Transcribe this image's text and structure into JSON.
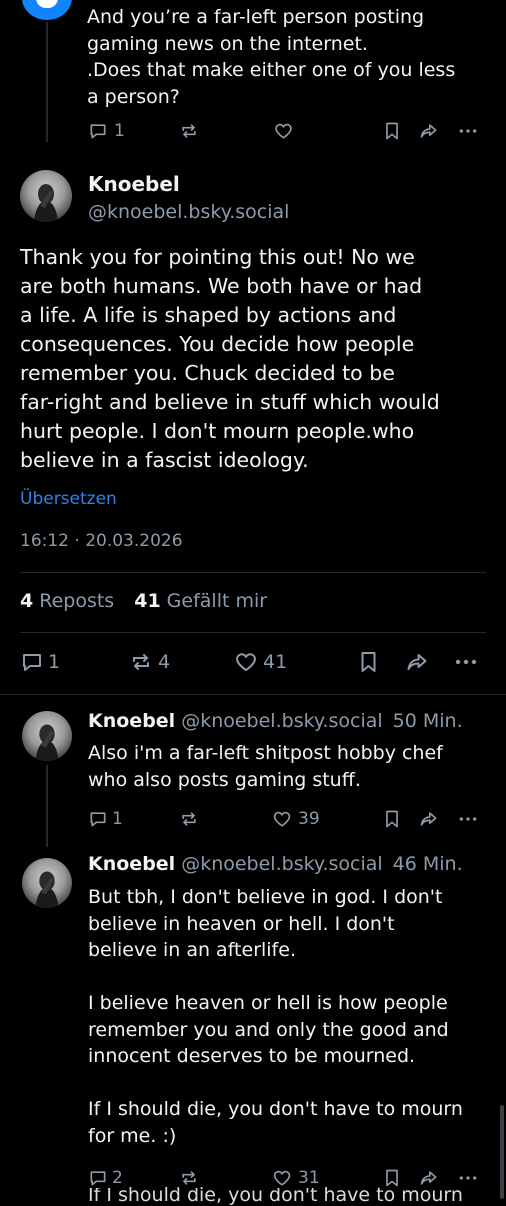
{
  "top_post": {
    "text_lines": [
      "And you’re a far-left person posting",
      "gaming news on the internet.",
      ".Does that make either one of you less",
      "a person?"
    ],
    "replies": "1"
  },
  "main_post": {
    "display_name": "Knoebel",
    "handle": "@knoebel.bsky.social",
    "text_lines": [
      "Thank you for pointing this out! No we",
      "are both humans. We both have or had",
      "a life. A life is shaped by actions and",
      "consequences. You decide how people",
      "remember you. Chuck decided to be",
      "far-right and believe in stuff which would",
      "hurt people. I don't mourn people.who",
      "believe in a fascist ideology."
    ],
    "translate": "Übersetzen",
    "timestamp": "16:12 · 20.03.2026",
    "reposts_count": "4",
    "reposts_label": "Reposts",
    "likes_count": "41",
    "likes_label": "Gefällt mir",
    "actions": {
      "replies": "1",
      "reposts": "4",
      "likes": "41"
    }
  },
  "reply1": {
    "display_name": "Knoebel",
    "handle": "@knoebel.bsky.social",
    "time": "50 Min.",
    "text_lines": [
      "Also i'm a far-left shitpost hobby chef",
      "who also posts gaming stuff."
    ],
    "replies": "1",
    "likes": "39"
  },
  "reply2": {
    "display_name": "Knoebel",
    "handle": "@knoebel.bsky.social",
    "time": "46 Min.",
    "text_lines": [
      "But tbh, I don't believe in god. I don't",
      "believe in heaven or hell. I don't",
      "believe in an afterlife.",
      "",
      "I believe heaven or hell is how people",
      "remember you and only the good and",
      "innocent deserves to be mourned.",
      "",
      "If I should die, you don't have to mourn",
      "for me. :)"
    ],
    "replies": "2",
    "likes": "31",
    "ghost_text": "If I should die, you don't have to mourn"
  },
  "colors": {
    "background": "#000000",
    "text": "#f1f3f5",
    "muted": "#8d9aa8",
    "link": "#2f84e9",
    "top_avatar": "#1185fe"
  }
}
